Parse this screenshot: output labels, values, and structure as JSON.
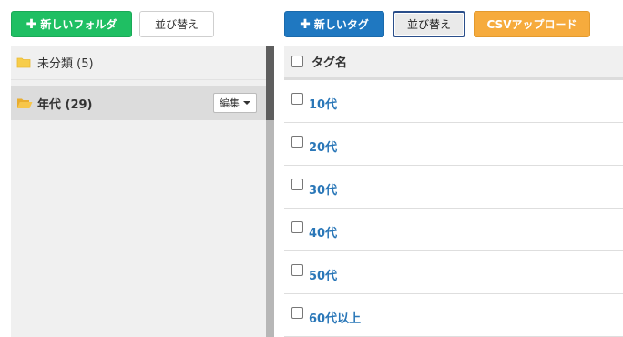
{
  "toolbar_left": {
    "new_folder_label": "新しいフォルダ",
    "sort_label": "並び替え"
  },
  "toolbar_right": {
    "new_tag_label": "新しいタグ",
    "sort_label": "並び替え",
    "csv_upload_label": "CSVアップロード"
  },
  "folders": [
    {
      "label": "未分類 (5)",
      "icon": "folder-closed-icon",
      "selected": false
    },
    {
      "label": "年代 (29)",
      "icon": "folder-open-icon",
      "selected": true,
      "edit_label": "編集"
    }
  ],
  "tags": {
    "header_label": "タグ名",
    "rows": [
      "10代",
      "20代",
      "30代",
      "40代",
      "50代",
      "60代以上"
    ]
  },
  "colors": {
    "green": "#1fbf63",
    "blue": "#1f78c1",
    "orange": "#f6ab3d",
    "link": "#2a77b8",
    "folder": "#f7cd4a"
  }
}
